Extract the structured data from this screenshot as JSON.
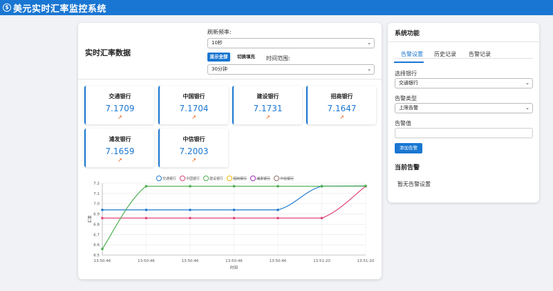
{
  "app": {
    "title": "美元实时汇率监控系统",
    "logo_icon": "$"
  },
  "left": {
    "title": "实时汇率数据",
    "refresh_label": "刷新频率:",
    "refresh_value": "10秒",
    "show_all_label": "显示全部",
    "toggle_fill_label": "切换填充",
    "time_range_label": "时间范围:",
    "time_range_value": "30分钟"
  },
  "rates": [
    {
      "bank": "交通银行",
      "value": "7.1709",
      "arrow": "↗"
    },
    {
      "bank": "中国银行",
      "value": "7.1704",
      "arrow": "↗"
    },
    {
      "bank": "建设银行",
      "value": "7.1731",
      "arrow": "↗"
    },
    {
      "bank": "招商银行",
      "value": "7.1647",
      "arrow": "↗"
    },
    {
      "bank": "浦发银行",
      "value": "7.1659",
      "arrow": "↗"
    },
    {
      "bank": "中信银行",
      "value": "7.2003",
      "arrow": "↗"
    }
  ],
  "right": {
    "title": "系统功能",
    "tabs": [
      "告警设置",
      "历史记录",
      "告警记录"
    ],
    "bank_label": "选择银行",
    "bank_value": "交通银行",
    "type_label": "告警类型",
    "type_value": "上限告警",
    "threshold_label": "告警值",
    "add_button": "添加告警",
    "current_title": "当前告警",
    "no_alert_text": "暂无告警设置"
  },
  "chart_data": {
    "type": "line",
    "x": [
      "13:50:46",
      "13:50:46",
      "13:50:46",
      "13:50:46",
      "13:50:46",
      "13:51:20",
      "13:51:20"
    ],
    "xlabel": "时间",
    "ylabel": "汇率",
    "ylim": [
      6.5,
      7.2
    ],
    "yticks": [
      6.5,
      6.6,
      6.7,
      6.8,
      6.9,
      7.0,
      7.1,
      7.2
    ],
    "grid": true,
    "legend_position": "top",
    "series": [
      {
        "name": "交通银行",
        "color": "#1e7ad1",
        "hidden": false,
        "values": [
          6.94,
          6.94,
          6.94,
          6.94,
          6.94,
          7.1709,
          7.1709
        ]
      },
      {
        "name": "中国银行",
        "color": "#e0457b",
        "hidden": false,
        "values": [
          6.86,
          6.86,
          6.86,
          6.86,
          6.86,
          6.86,
          7.1704
        ]
      },
      {
        "name": "建设银行",
        "color": "#4caf50",
        "hidden": false,
        "values": [
          6.56,
          7.17,
          7.17,
          7.17,
          7.17,
          7.17,
          7.1731
        ]
      },
      {
        "name": "招商银行",
        "color": "#f5b400",
        "hidden": true,
        "values": []
      },
      {
        "name": "浦发银行",
        "color": "#9c27b0",
        "hidden": true,
        "values": []
      },
      {
        "name": "中信银行",
        "color": "#8d6e63",
        "hidden": true,
        "values": []
      }
    ]
  }
}
